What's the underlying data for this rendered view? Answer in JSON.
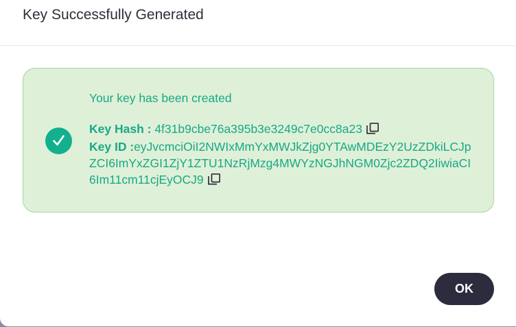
{
  "dialog": {
    "title": "Key Successfully Generated",
    "message": "Your key has been created",
    "key_hash_label": "Key Hash : ",
    "key_hash_value": "4f31b9cbe76a395b3e3249c7e0cc8a23",
    "key_id_label": "Key ID :",
    "key_id_value": "eyJvcmciOiI2NWIxMmYxMWJkZjg0YTAwMDEzY2UzZDkiLCJpZCI6ImYxZGI1ZjY1ZTU1NzRjMzg4MWYzNGJhNGM0Zjc2ZDQ2IiwiaCI6Im11cm11cjEyOCJ9",
    "ok_label": "OK",
    "success_icon": "check-circle-icon",
    "copy_icon": "copy-icon",
    "accent_color": "#17a984",
    "box_background": "#dff0d8",
    "button_color": "#2c2c3e"
  }
}
